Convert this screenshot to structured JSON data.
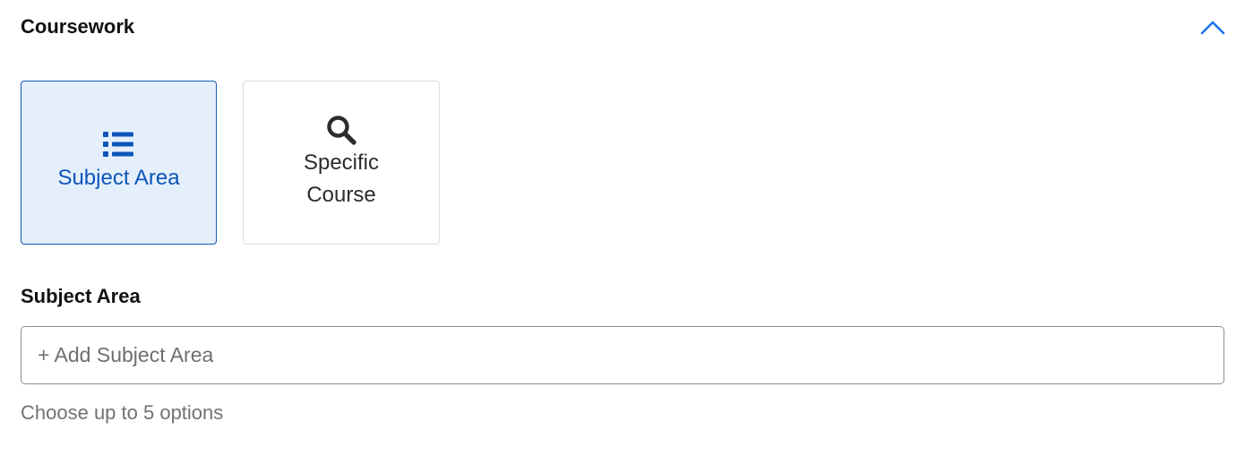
{
  "section": {
    "title": "Coursework",
    "collapse_icon": "chevron-up-icon",
    "accent_color": "#1a73e8"
  },
  "options": [
    {
      "label": "Subject Area",
      "icon": "list-icon",
      "selected": true
    },
    {
      "label": "Specific Course",
      "icon": "search-icon",
      "selected": false
    }
  ],
  "subject_field": {
    "label": "Subject Area",
    "placeholder": "+ Add Subject Area",
    "helper": "Choose up to 5 options"
  },
  "colors": {
    "selected_bg": "#e5effc",
    "selected_border": "#1656b8",
    "selected_text": "#0b56b8"
  }
}
